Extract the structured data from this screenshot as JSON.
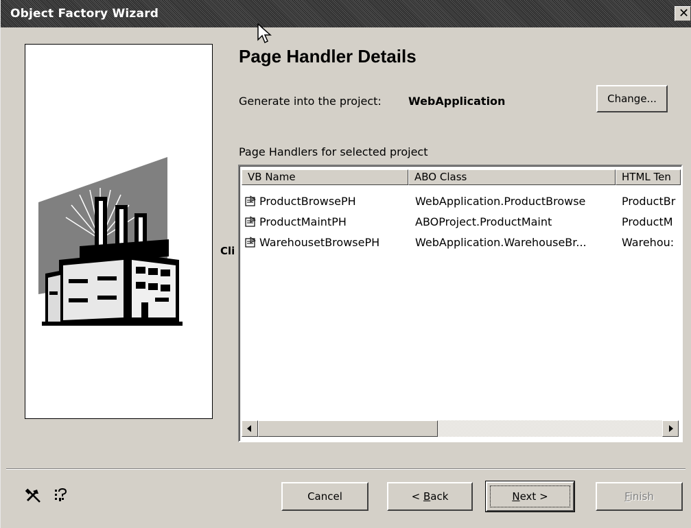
{
  "window": {
    "title": "Object Factory Wizard",
    "close_glyph": "✕"
  },
  "header": {
    "title": "Page Handler Details",
    "generate_label": "Generate into the project:",
    "project_name": "WebApplication",
    "change_button": "Change..."
  },
  "list": {
    "label": "Page Handlers for selected project",
    "columns": [
      "VB Name",
      "ABO Class",
      "HTML Ten"
    ],
    "rows": [
      {
        "vb_name": "ProductBrowsePH",
        "abo_class": "WebApplication.ProductBrowse",
        "html_template": "ProductBr"
      },
      {
        "vb_name": "ProductMaintPH",
        "abo_class": "ABOProject.ProductMaint",
        "html_template": "ProductM"
      },
      {
        "vb_name": "WarehousetBrowsePH",
        "abo_class": "WebApplication.WarehouseBr...",
        "html_template": "Warehou:"
      }
    ],
    "row_icon": "page-handler-icon"
  },
  "stray_text": "Cli",
  "footer": {
    "cancel": "Cancel",
    "back_prefix": "< ",
    "back_key": "B",
    "back_suffix": "ack",
    "next_key": "N",
    "next_suffix": "ext >",
    "finish_key": "F",
    "finish_suffix": "inish"
  },
  "icons": {
    "left_tool": "tools-icon",
    "right_tool": "help-icon",
    "art": "factory-illustration"
  },
  "colors": {
    "dialog_bg": "#d4d0c8",
    "title_bar": "#3a3a3a"
  }
}
